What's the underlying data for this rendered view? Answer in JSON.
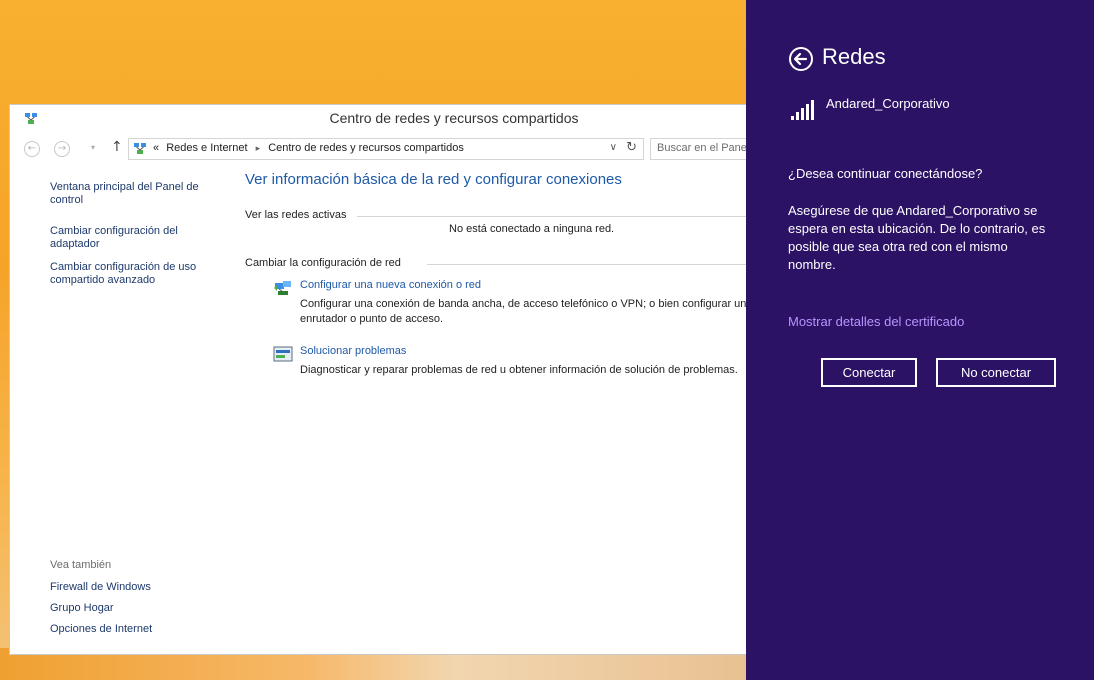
{
  "window": {
    "title": "Centro de redes y recursos compartidos",
    "breadcrumb_prefix": "«",
    "breadcrumbs": [
      "Redes e Internet",
      "Centro de redes y recursos compartidos"
    ],
    "search_placeholder": "Buscar en el Panel de control"
  },
  "leftpane": {
    "links": [
      "Ventana principal del Panel de control",
      "Cambiar configuración del adaptador",
      "Cambiar configuración de uso compartido avanzado"
    ],
    "see_also_title": "Vea también",
    "see_also": [
      "Firewall de Windows",
      "Grupo Hogar",
      "Opciones de Internet"
    ]
  },
  "main": {
    "heading": "Ver información básica de la red y configurar conexiones",
    "active_networks_label": "Ver las redes activas",
    "no_network_text": "No está conectado a ninguna red.",
    "change_settings_label": "Cambiar la configuración de red",
    "tasks": [
      {
        "link": "Configurar una nueva conexión o red",
        "description_line1": "Configurar una conexión de banda ancha, de acceso telefónico o VPN; o bien configurar un",
        "description_line2": "enrutador o punto de acceso.",
        "icon": "new-connection-icon"
      },
      {
        "link": "Solucionar problemas",
        "description_line1": "Diagnosticar y reparar problemas de red u obtener información de solución de problemas.",
        "icon": "troubleshoot-icon"
      }
    ]
  },
  "charm": {
    "title": "Redes",
    "network_name": "Andared_Corporativo",
    "question": "¿Desea continuar conectándose?",
    "message": "Asegúrese de que Andared_Corporativo se espera en esta ubicación. De lo contrario, es posible que sea otra red con el mismo nombre.",
    "cert_link": "Mostrar detalles del certificado",
    "connect_label": "Conectar",
    "dont_connect_label": "No conectar",
    "background_color": "#2b1264",
    "link_color": "#b894ff"
  }
}
